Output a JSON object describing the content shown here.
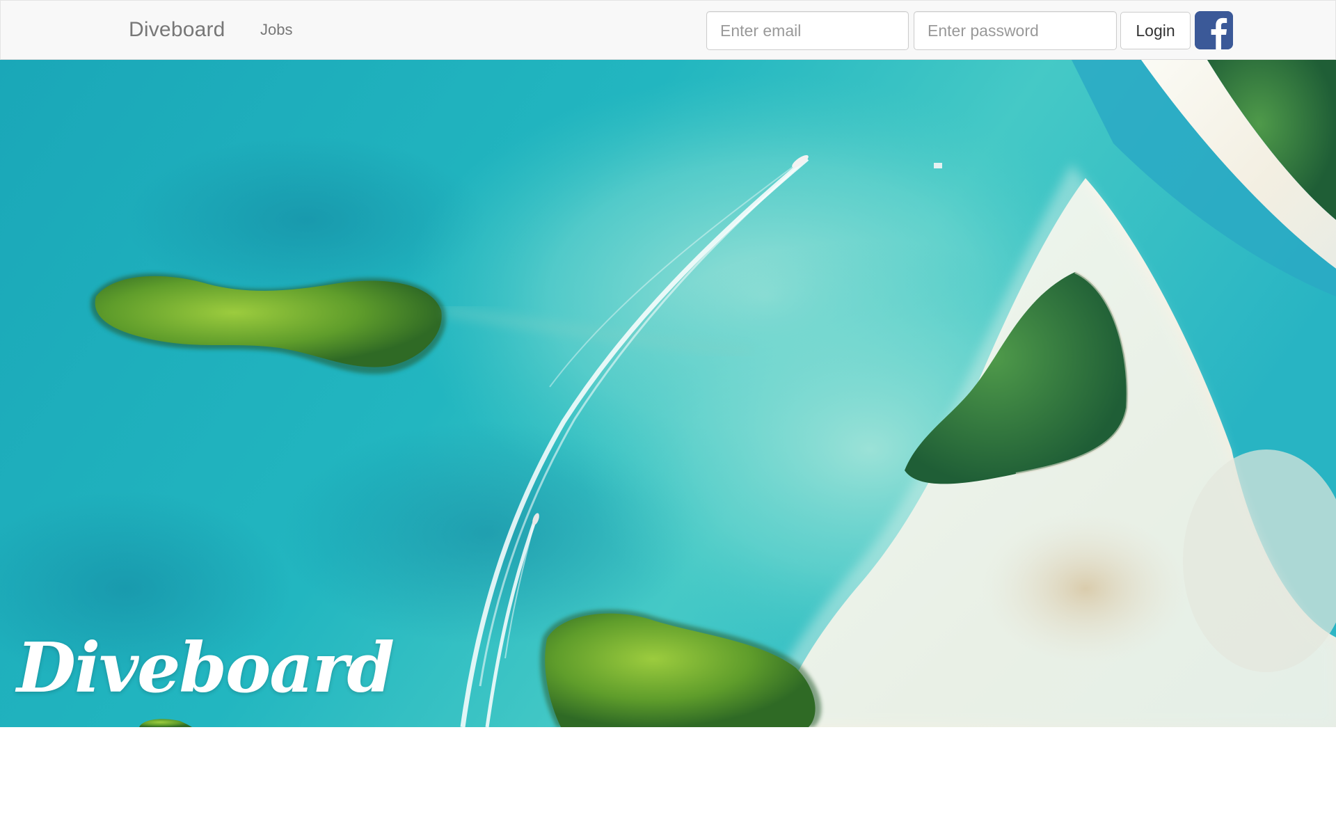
{
  "navbar": {
    "brand": "Diveboard",
    "links": [
      {
        "label": "Jobs"
      }
    ],
    "login_form": {
      "email_placeholder": "Enter email",
      "password_placeholder": "Enter password",
      "login_label": "Login"
    },
    "social": {
      "icon": "facebook-icon",
      "color": "#3b5998"
    }
  },
  "hero": {
    "logo_text": "Diveboard",
    "image": "aerial-view-turquoise-sea-islands-boats"
  },
  "colors": {
    "navbar_bg": "#f8f8f8",
    "nav_text": "#777777",
    "sea": "#1fb0bd",
    "facebook": "#3b5998"
  }
}
